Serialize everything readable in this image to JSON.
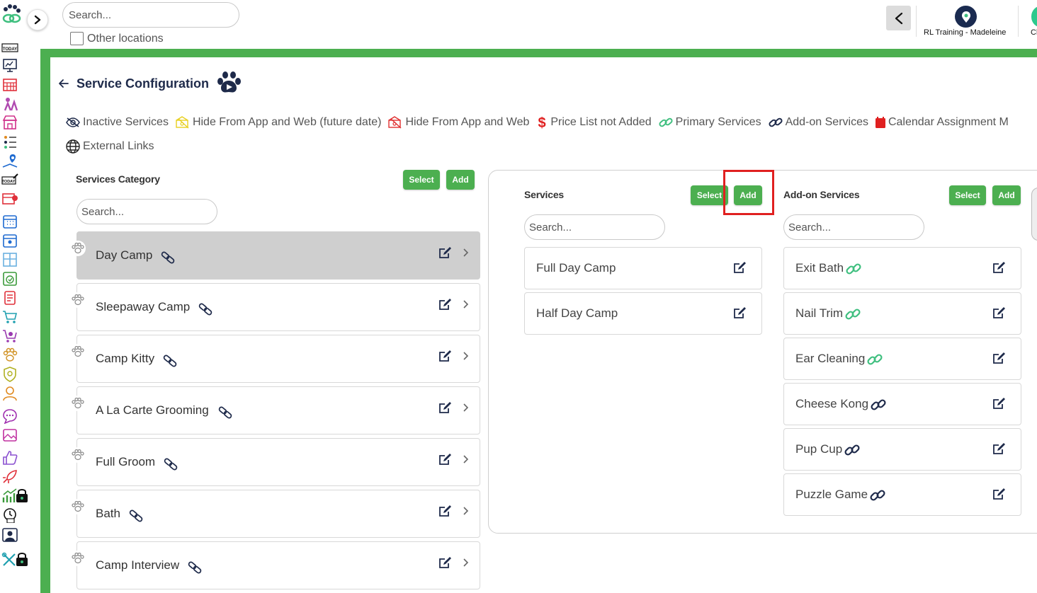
{
  "top": {
    "search_placeholder": "Search...",
    "other_locations_label": "Other locations",
    "location_name": "RL Training - Madeleine",
    "next_location_partial": "Cl"
  },
  "page": {
    "title": "Service Configuration"
  },
  "legend": {
    "items": [
      {
        "label": "Inactive Services",
        "icon": "eye-slash-icon"
      },
      {
        "label": "Hide From App and Web (future date)",
        "icon": "hidden-future-icon"
      },
      {
        "label": "Hide From App and Web",
        "icon": "hidden-icon"
      },
      {
        "label": "Price List not Added",
        "icon": "dollar-icon"
      },
      {
        "label": "Primary Services",
        "icon": "link-icon"
      },
      {
        "label": "Add-on Services",
        "icon": "link-icon"
      },
      {
        "label": "Calendar Assignment M",
        "icon": "calendar-icon"
      },
      {
        "label": "External Links",
        "icon": "globe-icon"
      }
    ]
  },
  "categories": {
    "title": "Services Category",
    "select_label": "Select",
    "add_label": "Add",
    "search_placeholder": "Search...",
    "items": [
      {
        "name": "Day Camp",
        "active": true
      },
      {
        "name": "Sleepaway Camp",
        "active": false
      },
      {
        "name": "Camp Kitty",
        "active": false
      },
      {
        "name": "A La Carte Grooming",
        "active": false
      },
      {
        "name": "Full Groom",
        "active": false
      },
      {
        "name": "Bath",
        "active": false
      },
      {
        "name": "Camp Interview",
        "active": false
      }
    ]
  },
  "services": {
    "title": "Services",
    "select_label": "Select",
    "add_label": "Add",
    "search_placeholder": "Search...",
    "items": [
      {
        "name": "Full Day Camp"
      },
      {
        "name": "Half Day Camp"
      }
    ]
  },
  "addons": {
    "title": "Add-on Services",
    "select_label": "Select",
    "add_label": "Add",
    "search_placeholder": "Search...",
    "items": [
      {
        "name": "Exit Bath",
        "link_color": "#3fbf7f"
      },
      {
        "name": "Nail Trim",
        "link_color": "#3fbf7f"
      },
      {
        "name": "Ear Cleaning",
        "link_color": "#3fbf7f"
      },
      {
        "name": "Cheese Kong",
        "link_color": "#1e2a4a"
      },
      {
        "name": "Pup Cup",
        "link_color": "#1e2a4a"
      },
      {
        "name": "Puzzle Game",
        "link_color": "#1e2a4a"
      }
    ]
  },
  "colors": {
    "accent_green": "#4caf50",
    "navy": "#1e2a4a",
    "highlight_red": "#e02020"
  }
}
